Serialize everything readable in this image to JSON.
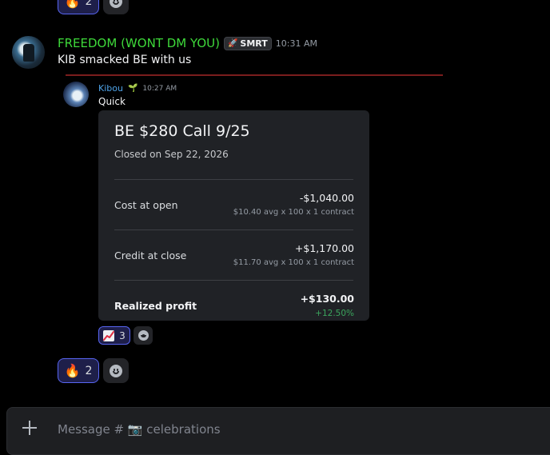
{
  "top_reactions": [
    {
      "emoji": "🔥",
      "count": "2"
    },
    {
      "icon": "add-reaction-icon"
    }
  ],
  "message": {
    "author": "FREEDOM (WONT DM YOU)",
    "author_color": "#3ed93a",
    "tag_icon": "🚀",
    "tag": "SMRT",
    "time": "10:31 AM",
    "text": "KIB smacked BE with us"
  },
  "forwarded": {
    "author": "Kibou",
    "author_icon": "🌱",
    "time": "10:27 AM",
    "text": "Quick",
    "card": {
      "title": "BE $280 Call 9/25",
      "subtitle": "Closed on Sep 22, 2026",
      "rows": [
        {
          "label": "Cost at open",
          "amount": "-$1,040.00",
          "detail": "$10.40 avg x 100 x 1 contract"
        },
        {
          "label": "Credit at close",
          "amount": "+$1,170.00",
          "detail": "$11.70 avg x 100 x 1 contract"
        },
        {
          "label": "Realized profit",
          "amount": "+$130.00",
          "detail": "+12.50%"
        }
      ]
    },
    "reactions": [
      {
        "icon": "chart-increasing-icon",
        "count": "3"
      },
      {
        "icon": "add-reaction-icon"
      }
    ]
  },
  "bottom_reactions": [
    {
      "emoji": "🔥",
      "count": "2"
    },
    {
      "icon": "add-reaction-icon"
    }
  ],
  "composer": {
    "placeholder": "Message # 📷 celebrations"
  },
  "colors": {
    "background": "#000000",
    "accent": "#5865f2",
    "profit_green": "#3ba55d",
    "divider_red": "#7a1d1d"
  }
}
